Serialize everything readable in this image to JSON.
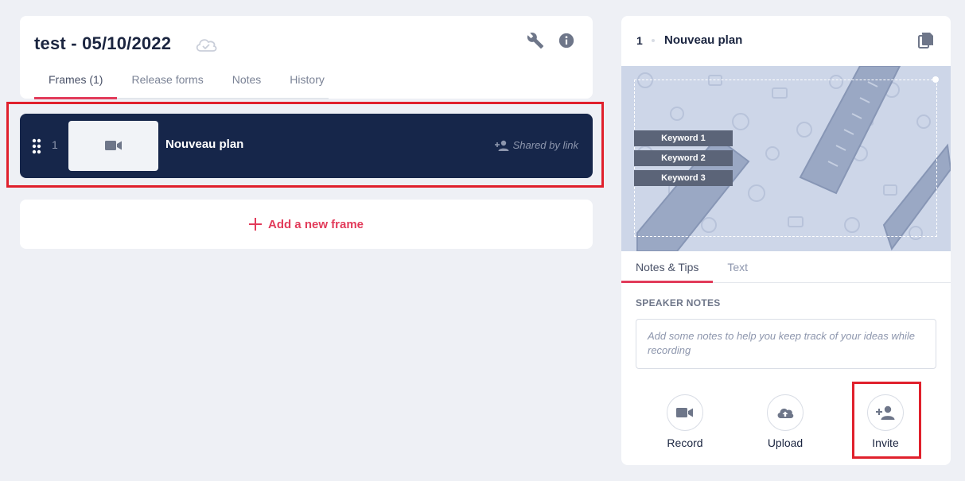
{
  "project": {
    "title": "test - 05/10/2022",
    "tabs": [
      {
        "label": "Frames (1)",
        "active": true
      },
      {
        "label": "Release forms",
        "active": false
      },
      {
        "label": "Notes",
        "active": false
      },
      {
        "label": "History",
        "active": false
      }
    ],
    "icons": [
      "cloud-check-icon",
      "wrench-icon",
      "info-icon"
    ]
  },
  "frames": [
    {
      "number": "1",
      "name": "Nouveau plan",
      "shared_label": "Shared by link",
      "thumbnail_icon": "video-camera-icon"
    }
  ],
  "add_frame": {
    "label": "Add a new frame",
    "icon": "plus-icon"
  },
  "side_panel": {
    "frame_number": "1",
    "frame_title": "Nouveau plan",
    "keywords": [
      "Keyword 1",
      "Keyword 2",
      "Keyword 3"
    ],
    "tabs": [
      {
        "label": "Notes & Tips",
        "active": true
      },
      {
        "label": "Text",
        "active": false
      }
    ],
    "notes_heading": "SPEAKER NOTES",
    "notes_placeholder": "Add some notes to help you keep track of your ideas while recording",
    "actions": [
      {
        "label": "Record",
        "icon": "video-camera-icon"
      },
      {
        "label": "Upload",
        "icon": "cloud-upload-icon"
      },
      {
        "label": "Invite",
        "icon": "add-person-icon"
      }
    ]
  },
  "colors": {
    "accent": "#e23b5a",
    "navy": "#16264a",
    "background": "#eef0f5",
    "highlight": "#e0202c",
    "icon_gray": "#6e7689"
  }
}
